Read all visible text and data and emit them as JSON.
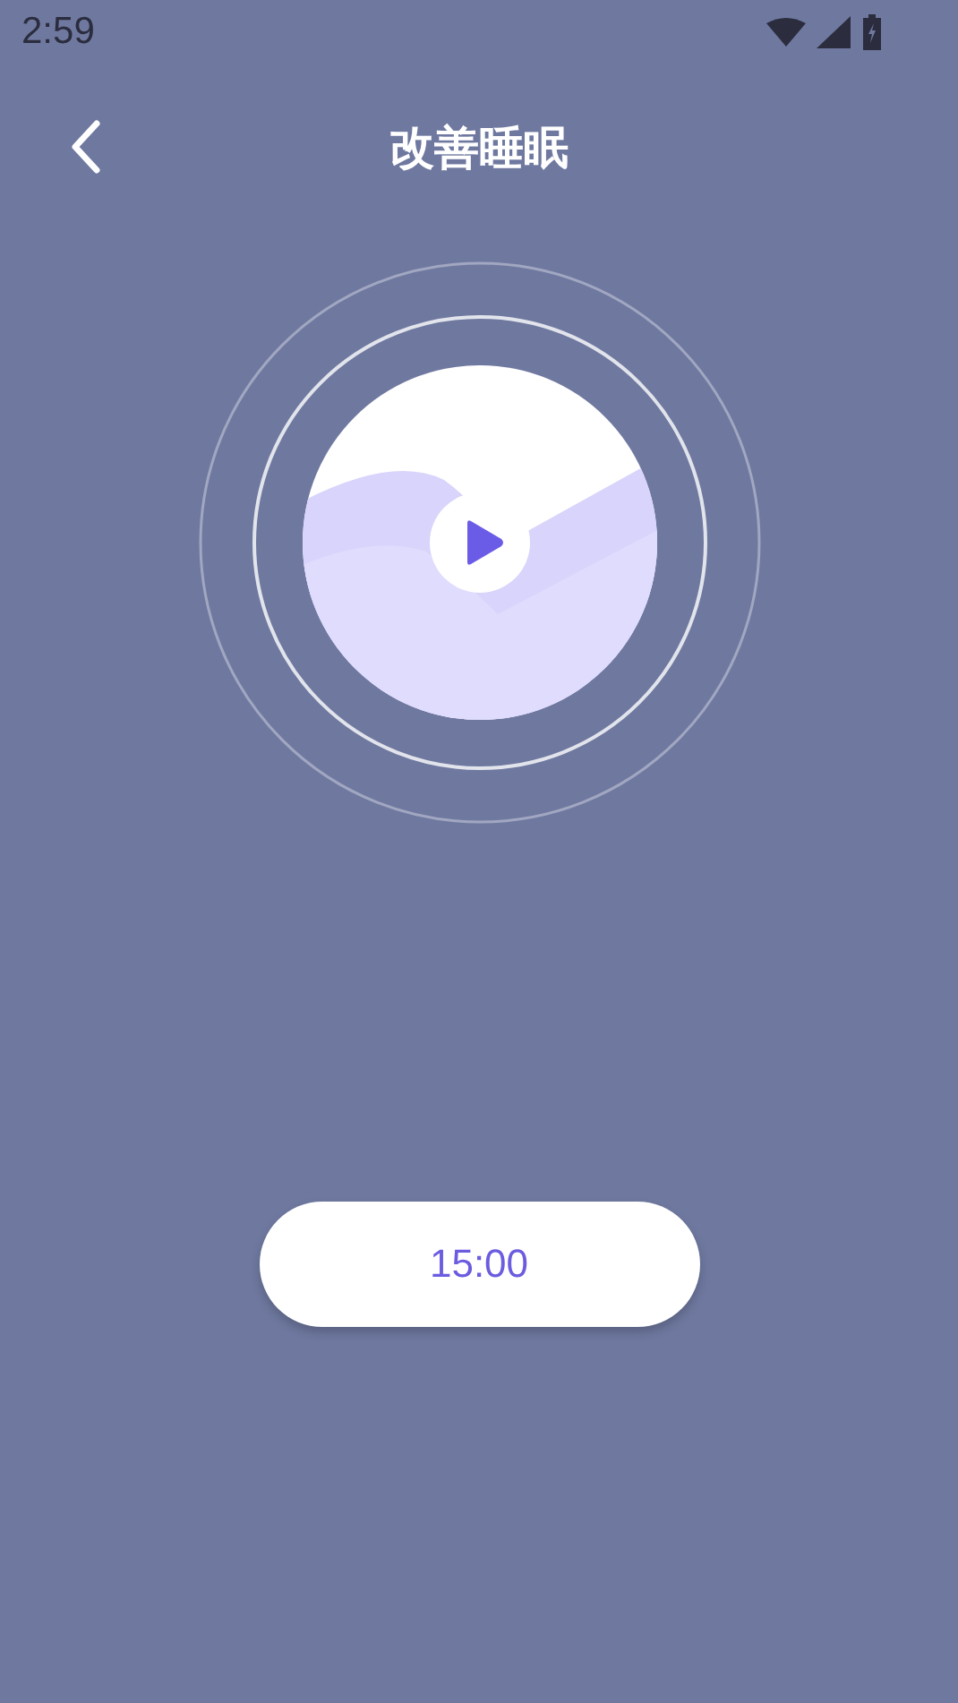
{
  "status_bar": {
    "time": "2:59"
  },
  "header": {
    "title": "改善睡眠"
  },
  "timer": {
    "label": "15:00"
  }
}
